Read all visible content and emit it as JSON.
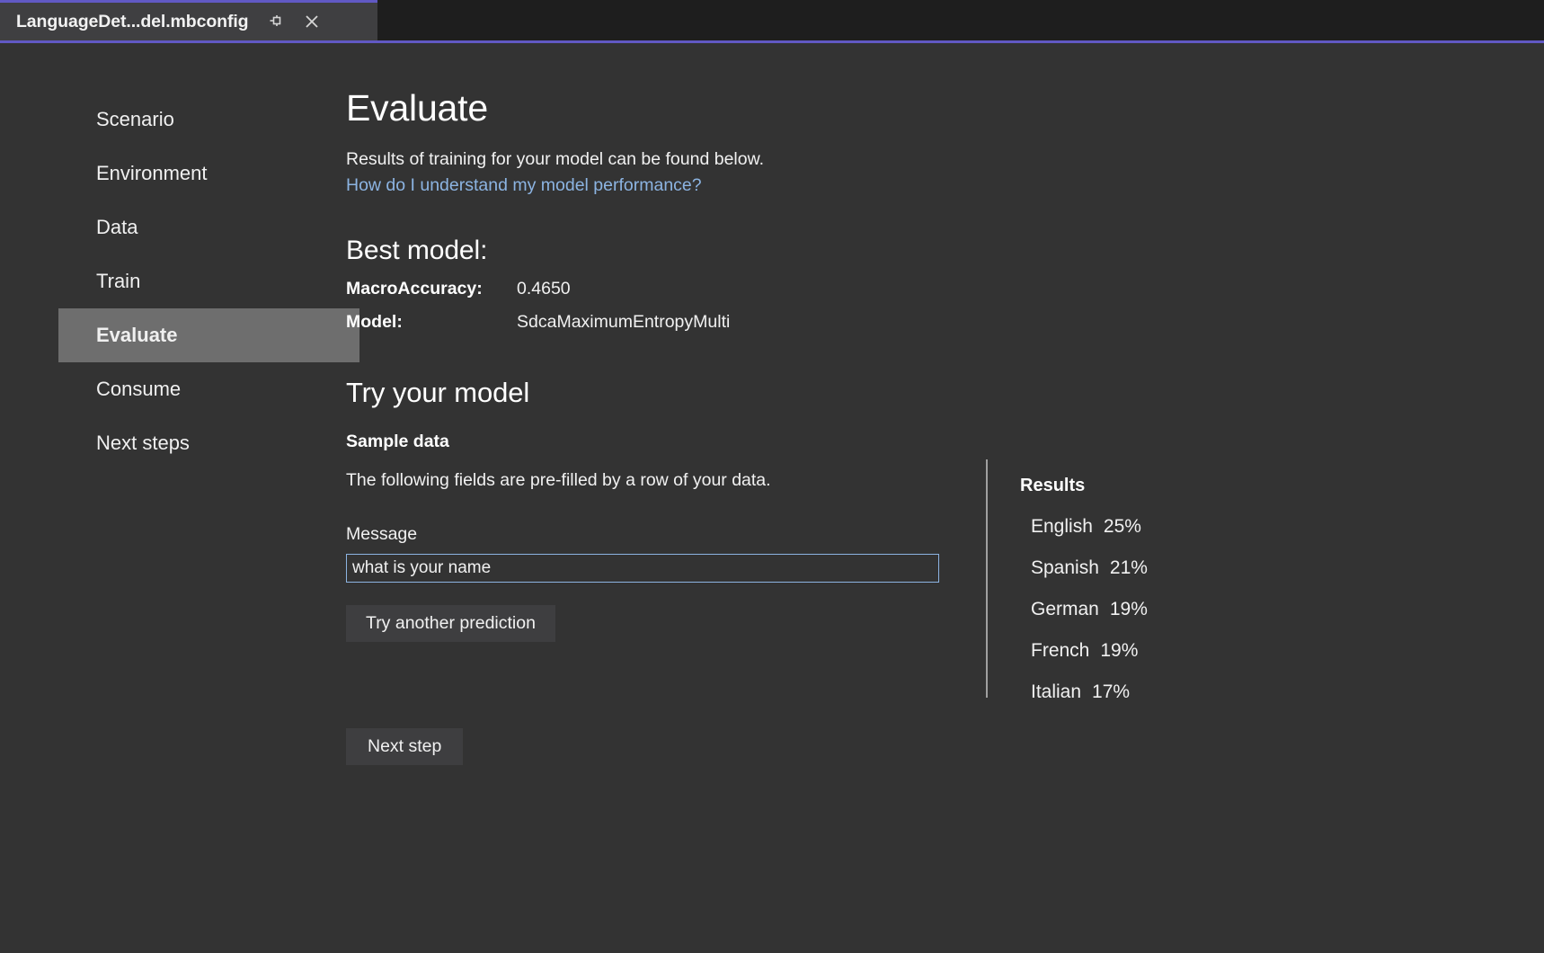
{
  "tab": {
    "title": "LanguageDet...del.mbconfig",
    "pin_icon": "pin-icon",
    "close_icon": "close-icon",
    "accent_color": "#6159c4"
  },
  "sidebar": {
    "items": [
      {
        "label": "Scenario",
        "selected": false
      },
      {
        "label": "Environment",
        "selected": false
      },
      {
        "label": "Data",
        "selected": false
      },
      {
        "label": "Train",
        "selected": false
      },
      {
        "label": "Evaluate",
        "selected": true
      },
      {
        "label": "Consume",
        "selected": false
      },
      {
        "label": "Next steps",
        "selected": false
      }
    ]
  },
  "main": {
    "title": "Evaluate",
    "intro": "Results of training for your model can be found below.",
    "help_link": "How do I understand my model performance?",
    "best_model": {
      "heading": "Best model:",
      "rows": [
        {
          "key": "MacroAccuracy:",
          "value": "0.4650"
        },
        {
          "key": "Model:",
          "value": "SdcaMaximumEntropyMulti"
        }
      ]
    },
    "try_model": {
      "heading": "Try your model",
      "sample_data_label": "Sample data",
      "sample_data_text": "The following fields are pre-filled by a row of your data.",
      "message_label": "Message",
      "message_value": "what is your name",
      "message_placeholder": "",
      "try_button": "Try another prediction"
    },
    "next_button": "Next step"
  },
  "results": {
    "title": "Results",
    "rows": [
      {
        "label": "English",
        "value": "25%"
      },
      {
        "label": "Spanish",
        "value": "21%"
      },
      {
        "label": "German",
        "value": "19%"
      },
      {
        "label": "French",
        "value": "19%"
      },
      {
        "label": "Italian",
        "value": "17%"
      }
    ]
  },
  "colors": {
    "background": "#333333",
    "tabstrip_background": "#1e1e1e",
    "tab_background": "#3f3f41",
    "accent": "#6159c4",
    "link": "#8cb4e2",
    "selection": "#6e6e6e"
  }
}
